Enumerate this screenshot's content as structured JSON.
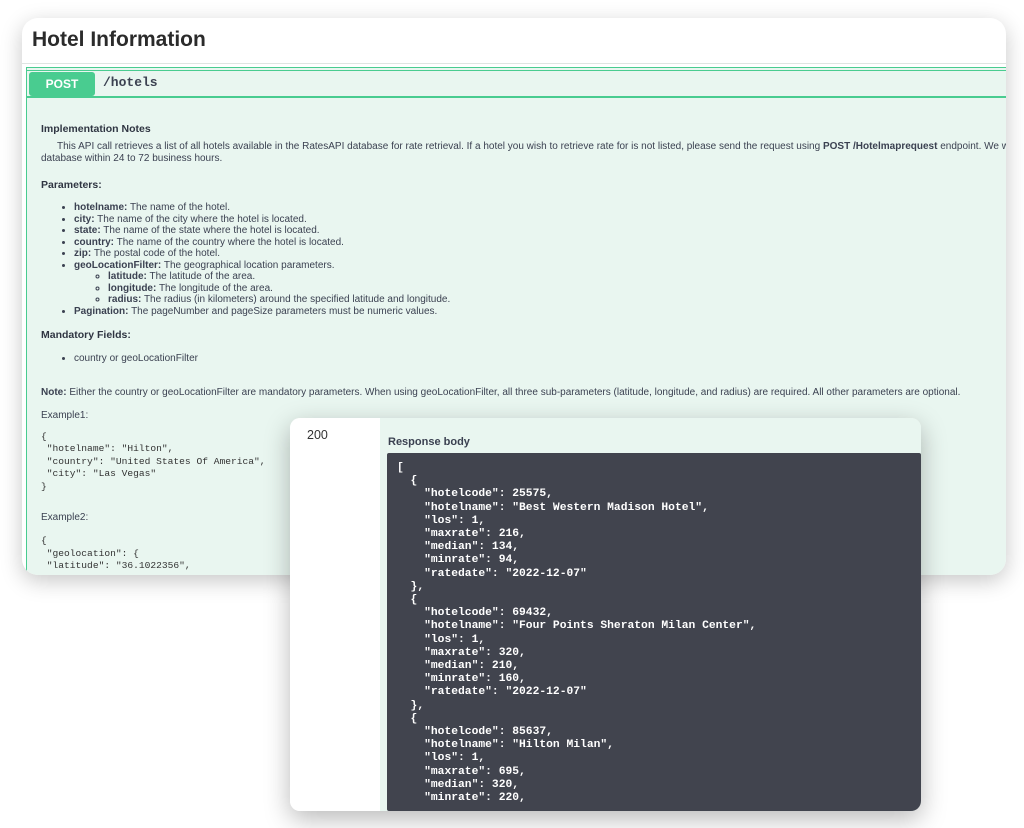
{
  "page_title": "Hotel Information",
  "operation": {
    "method": "POST",
    "path": "/hotels"
  },
  "implementation_notes": {
    "heading": "Implementation Notes",
    "line1": "This API call retrieves a list of all hotels available in the RatesAPI database for rate retrieval. If a hotel you wish to retrieve rate for is not listed, please send the request using",
    "endpoint": "POST /Hotelmaprequest",
    "line1_end": "endpoint. We will",
    "line2": "database within 24 to 72 business hours."
  },
  "parameters": {
    "heading": "Parameters:",
    "items": [
      {
        "name": "hotelname:",
        "desc": "The name of the hotel."
      },
      {
        "name": "city:",
        "desc": "The name of the city where the hotel is located."
      },
      {
        "name": "state:",
        "desc": "The name of the state where the hotel is located."
      },
      {
        "name": "country:",
        "desc": "The name of the country where the hotel is located."
      },
      {
        "name": "zip:",
        "desc": "The postal code of the hotel."
      },
      {
        "name": "geoLocationFilter:",
        "desc": "The geographical location parameters."
      }
    ],
    "sub_items": [
      {
        "name": "latitude:",
        "desc": "The latitude of the area."
      },
      {
        "name": "longitude:",
        "desc": "The longitude of the area."
      },
      {
        "name": "radius:",
        "desc": "The radius (in kilometers) around the specified latitude and longitude."
      }
    ],
    "pagination": {
      "name": "Pagination:",
      "desc": "The pageNumber and pageSize parameters must be numeric values."
    }
  },
  "mandatory": {
    "heading": "Mandatory Fields:",
    "item": "country or geoLocationFilter"
  },
  "note": {
    "label": "Note:",
    "text": "Either the country or geoLocationFilter are mandatory parameters. When using geoLocationFilter, all three sub-parameters (latitude, longitude, and radius) are required. All other parameters are optional."
  },
  "example1": {
    "label": "Example1:",
    "code": "{\n \"hotelname\": \"Hilton\",\n \"country\": \"United States Of America\",\n \"city\": \"Las Vegas\"\n}"
  },
  "example2": {
    "label": "Example2:",
    "code": "{\n \"geolocation\": {\n \"latitude\": \"36.1022356\","
  },
  "response": {
    "status_code": "200",
    "body_label": "Response body",
    "body": "[\n  {\n    \"hotelcode\": 25575,\n    \"hotelname\": \"Best Western Madison Hotel\",\n    \"los\": 1,\n    \"maxrate\": 216,\n    \"median\": 134,\n    \"minrate\": 94,\n    \"ratedate\": \"2022-12-07\"\n  },\n  {\n    \"hotelcode\": 69432,\n    \"hotelname\": \"Four Points Sheraton Milan Center\",\n    \"los\": 1,\n    \"maxrate\": 320,\n    \"median\": 210,\n    \"minrate\": 160,\n    \"ratedate\": \"2022-12-07\"\n  },\n  {\n    \"hotelcode\": 85637,\n    \"hotelname\": \"Hilton Milan\",\n    \"los\": 1,\n    \"maxrate\": 695,\n    \"median\": 320,\n    \"minrate\": 220,"
  },
  "colors": {
    "post_green": "#49cc90",
    "op_background": "#e9f6f0",
    "code_background": "#41444e"
  }
}
